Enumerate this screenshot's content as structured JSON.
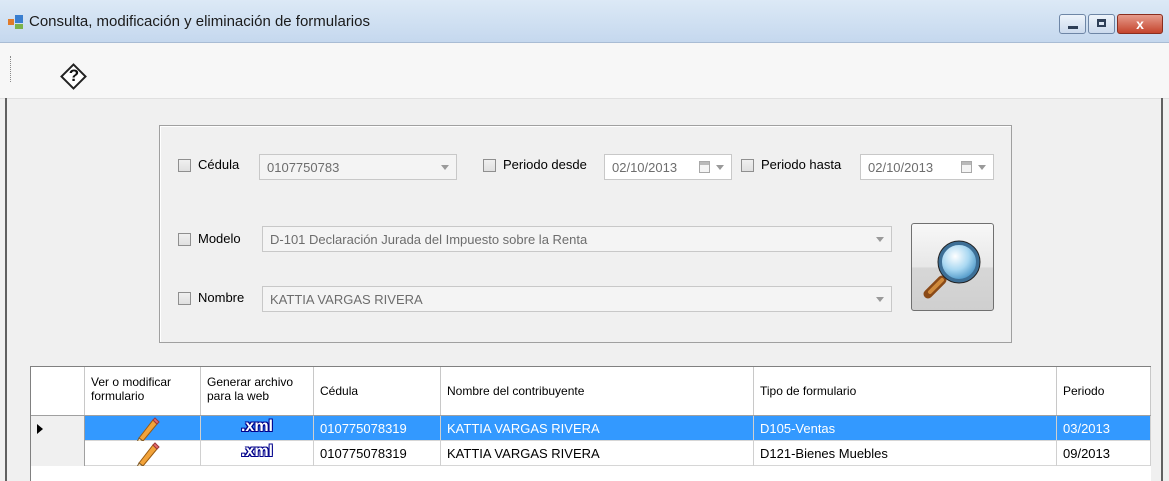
{
  "window": {
    "title": "Consulta, modificación y eliminación de formularios",
    "close_label": "x"
  },
  "toolbar": {
    "help_glyph": "?"
  },
  "filters": {
    "cedula": {
      "label": "Cédula",
      "value": "0107750783",
      "checked": false
    },
    "periodo_desde": {
      "label": "Periodo desde",
      "value": "02/10/2013",
      "checked": false
    },
    "periodo_hasta": {
      "label": "Periodo hasta",
      "value": "02/10/2013",
      "checked": false
    },
    "modelo": {
      "label": "Modelo",
      "value": "D-101 Declaración Jurada del Impuesto sobre la Renta",
      "checked": false
    },
    "nombre": {
      "label": "Nombre",
      "value": "KATTIA VARGAS RIVERA",
      "checked": false
    }
  },
  "search_button": {
    "icon": "magnifier-icon"
  },
  "grid": {
    "columns": {
      "ver_line1": "Ver o modificar",
      "ver_line2": "formulario",
      "gen_line1": "Generar archivo",
      "gen_line2": "para la web",
      "cedula": "Cédula",
      "nombre": "Nombre del contribuyente",
      "tipo": "Tipo de formulario",
      "periodo": "Periodo"
    },
    "rows": [
      {
        "xml": ".xml",
        "cedula": "010775078319",
        "nombre": "KATTIA VARGAS RIVERA",
        "tipo": "D105-Ventas",
        "periodo": "03/2013",
        "selected": true
      },
      {
        "xml": ".xml",
        "cedula": "010775078319",
        "nombre": "KATTIA VARGAS RIVERA",
        "tipo": "D121-Bienes Muebles",
        "periodo": "09/2013",
        "selected": false
      }
    ]
  },
  "colors": {
    "selection": "#3399ff",
    "titlebar": "#c5d8ee",
    "close_button": "#c4442c"
  }
}
